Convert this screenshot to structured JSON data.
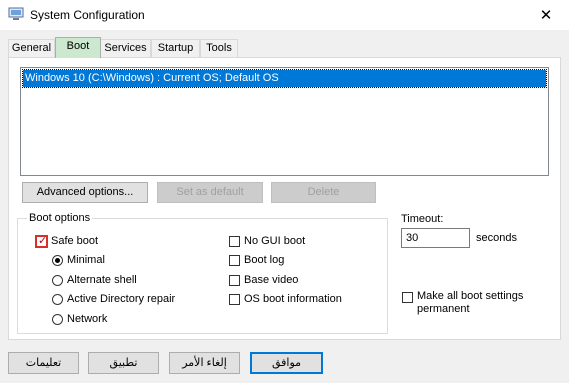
{
  "window": {
    "title": "System Configuration"
  },
  "tabs": [
    {
      "label": "General"
    },
    {
      "label": "Boot"
    },
    {
      "label": "Services"
    },
    {
      "label": "Startup"
    },
    {
      "label": "Tools"
    }
  ],
  "os_list": {
    "items": [
      "Windows 10 (C:\\Windows) : Current OS; Default OS"
    ]
  },
  "buttons": {
    "advanced": "Advanced options...",
    "set_default": "Set as default",
    "delete": "Delete"
  },
  "boot_options": {
    "group_label": "Boot options",
    "safe_boot": "Safe boot",
    "minimal": "Minimal",
    "alternate_shell": "Alternate shell",
    "active_directory_repair": "Active Directory repair",
    "network": "Network",
    "no_gui_boot": "No GUI boot",
    "boot_log": "Boot log",
    "base_video": "Base video",
    "os_boot_information": "OS boot information"
  },
  "timeout": {
    "label": "Timeout:",
    "value": "30",
    "unit": "seconds"
  },
  "make_permanent": {
    "line1": "Make all boot settings",
    "line2": "permanent"
  },
  "footer": {
    "ok": "موافق",
    "cancel": "إلغاء الأمر",
    "apply": "تطبيق",
    "help": "تعليمات"
  },
  "icons": {
    "app": "system-config-icon",
    "close": "close-icon"
  },
  "colors": {
    "selection": "#0078d7",
    "active_tab": "#cce8cf",
    "highlight": "#d93025"
  }
}
